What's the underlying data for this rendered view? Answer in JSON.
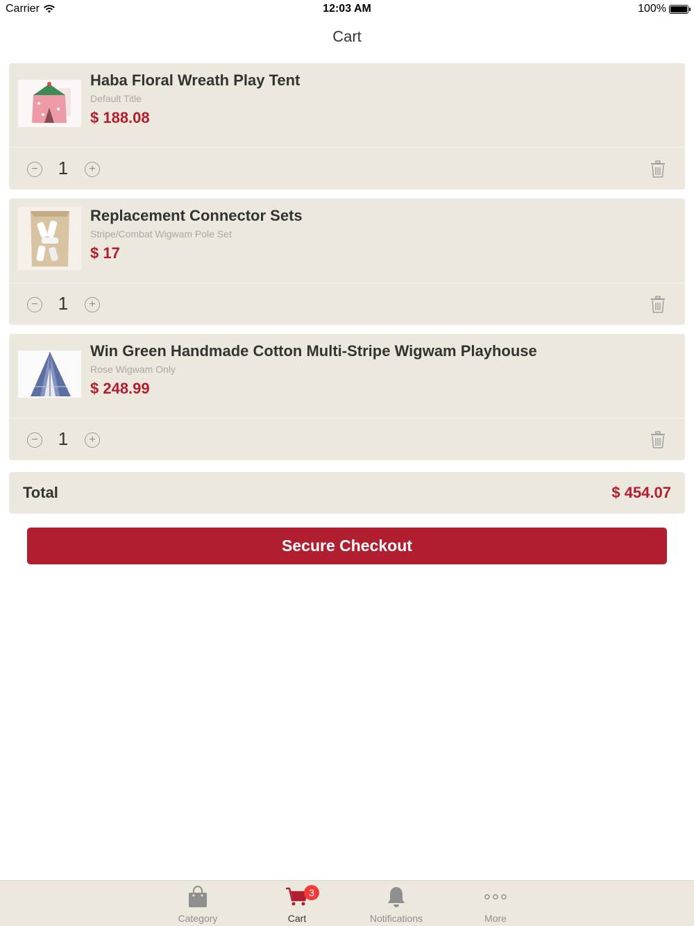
{
  "status_bar": {
    "carrier": "Carrier",
    "time": "12:03 AM",
    "battery": "100%"
  },
  "nav": {
    "title": "Cart"
  },
  "cart": {
    "items": [
      {
        "name": "Haba Floral Wreath Play Tent",
        "variant": "Default Title",
        "price": "$ 188.08",
        "quantity": "1"
      },
      {
        "name": "Replacement Connector Sets",
        "variant": "Stripe/Combat Wigwam Pole Set",
        "price": "$ 17",
        "quantity": "1"
      },
      {
        "name": "Win Green Handmade Cotton Multi-Stripe Wigwam Playhouse",
        "variant": "Rose Wigwam Only",
        "price": "$ 248.99",
        "quantity": "1"
      }
    ],
    "total_label": "Total",
    "total_amount": "$ 454.07",
    "checkout_label": "Secure Checkout"
  },
  "tab_bar": {
    "tabs": [
      {
        "label": "Category",
        "icon": "shopping-bag-icon"
      },
      {
        "label": "Cart",
        "icon": "cart-icon",
        "badge": "3",
        "active": true
      },
      {
        "label": "Notifications",
        "icon": "bell-icon"
      },
      {
        "label": "More",
        "icon": "more-dots-icon"
      }
    ]
  },
  "colors": {
    "accent": "#b01e2f",
    "card_background": "#ece8dd",
    "badge": "#f33a3a"
  }
}
